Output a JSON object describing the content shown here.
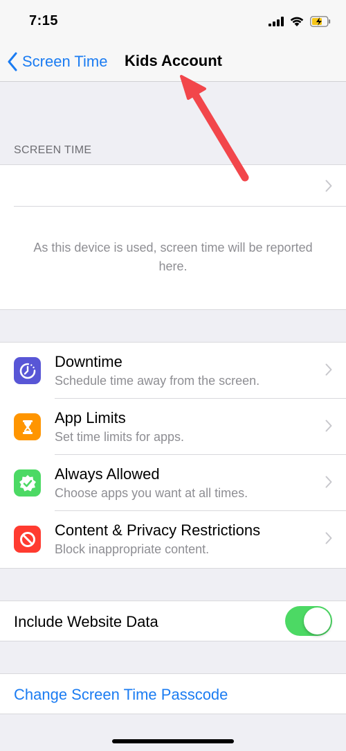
{
  "status_bar": {
    "time": "7:15",
    "icons": [
      "signal-icon",
      "wifi-icon",
      "battery-charging-icon"
    ]
  },
  "nav": {
    "back_label": "Screen Time",
    "title": "Kids Account"
  },
  "screen_time_section": {
    "header": "SCREEN TIME",
    "message": "As this device is used, screen time will be reported here."
  },
  "options": [
    {
      "title": "Downtime",
      "subtitle": "Schedule time away from the screen.",
      "icon": "downtime-icon",
      "color": "#5856d6"
    },
    {
      "title": "App Limits",
      "subtitle": "Set time limits for apps.",
      "icon": "hourglass-icon",
      "color": "#ff9500"
    },
    {
      "title": "Always Allowed",
      "subtitle": "Choose apps you want at all times.",
      "icon": "checkmark-badge-icon",
      "color": "#4cd964"
    },
    {
      "title": "Content & Privacy Restrictions",
      "subtitle": "Block inappropriate content.",
      "icon": "restriction-icon",
      "color": "#ff3b30"
    }
  ],
  "website_data": {
    "label": "Include Website Data",
    "enabled": true
  },
  "passcode": {
    "label": "Change Screen Time Passcode"
  },
  "colors": {
    "accent": "#1b7cf2",
    "toggle_on": "#4cd964",
    "annotation_arrow": "#f2464b"
  }
}
